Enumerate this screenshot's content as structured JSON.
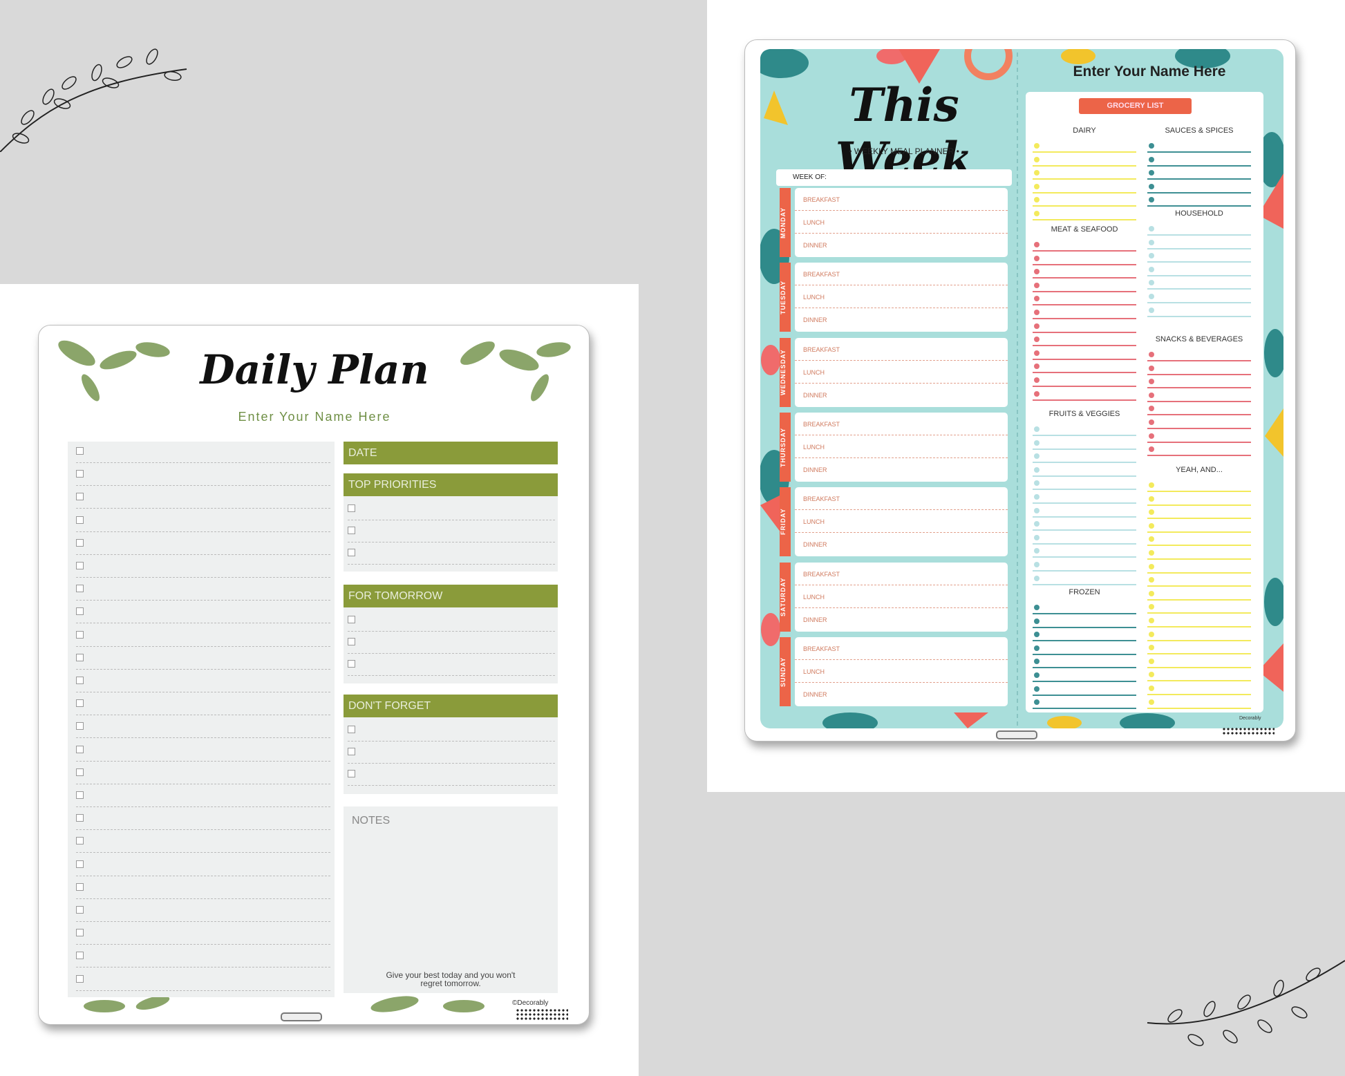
{
  "daily_plan": {
    "title": "Daily Plan",
    "name_placeholder": "Enter Your Name Here",
    "sections": {
      "date": "DATE",
      "top_priorities": "TOP PRIORITIES",
      "for_tomorrow": "FOR TOMORROW",
      "dont_forget": "DON'T FORGET",
      "notes": "NOTES"
    },
    "quote": "Give your best today and you won't regret tomorrow.",
    "brand": "©Decorably",
    "accent": "#8a9b3a"
  },
  "meal_planner": {
    "title": "This Week",
    "subtitle": "• WEEKLY MEAL PLANNER •",
    "week_of": "WEEK OF:",
    "name_placeholder": "Enter Your Name Here",
    "days": [
      "MONDAY",
      "TUESDAY",
      "WEDNESDAY",
      "THURSDAY",
      "FRIDAY",
      "SATURDAY",
      "SUNDAY"
    ],
    "meals": [
      "BREAKFAST",
      "LUNCH",
      "DINNER"
    ],
    "grocery_list": {
      "label": "GROCERY LIST",
      "sections": {
        "dairy": "DAIRY",
        "meat_seafood": "MEAT & SEAFOOD",
        "fruits_veggies": "FRUITS & VEGGIES",
        "frozen": "FROZEN",
        "sauces_spices": "SAUCES & SPICES",
        "household": "HOUSEHOLD",
        "snacks_beverages": "SNACKS & BEVERAGES",
        "yeah_and": "YEAH, AND..."
      }
    },
    "brand": "Decorably",
    "colors": {
      "background": "#a9dedb",
      "accent": "#ec6448",
      "yellow": "#f3ea5c",
      "red": "#e6707a",
      "teal": "#3d8f93",
      "light": "#b8e0e3"
    }
  }
}
